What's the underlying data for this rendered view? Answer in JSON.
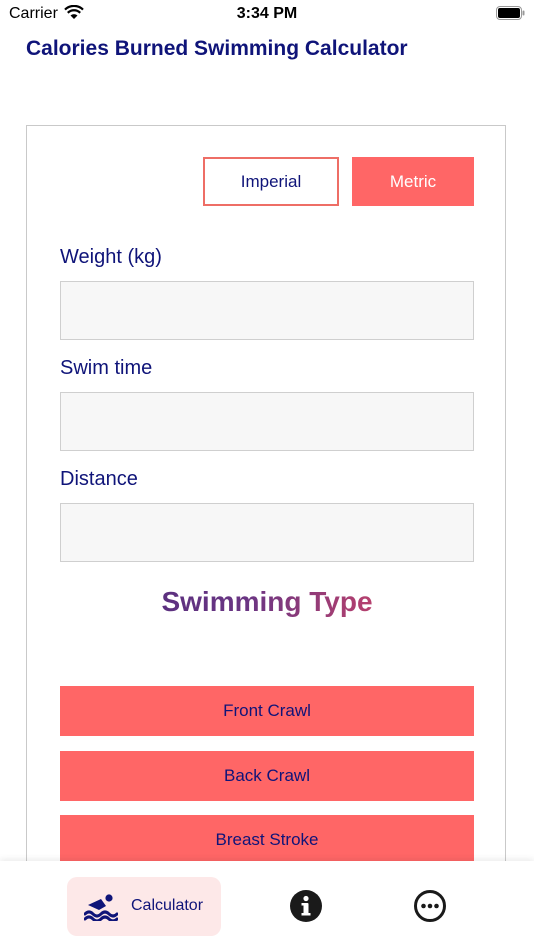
{
  "status_bar": {
    "carrier": "Carrier",
    "time": "3:34 PM"
  },
  "header": {
    "title": "Calories Burned Swimming Calculator"
  },
  "units": {
    "imperial_label": "Imperial",
    "metric_label": "Metric",
    "selected": "Metric"
  },
  "fields": [
    {
      "label": "Weight (kg)",
      "value": ""
    },
    {
      "label": "Swim time",
      "value": ""
    },
    {
      "label": "Distance",
      "value": ""
    }
  ],
  "swimming_type": {
    "title": "Swimming Type",
    "options": [
      "Front Crawl",
      "Back Crawl",
      "Breast Stroke"
    ]
  },
  "tab_bar": {
    "items": [
      {
        "label": "Calculator",
        "icon": "swimmer-icon",
        "active": true
      },
      {
        "label": "",
        "icon": "info-icon",
        "active": false
      },
      {
        "label": "",
        "icon": "more-icon",
        "active": false
      }
    ]
  },
  "colors": {
    "accent": "#ff6666",
    "navy": "#0f1479",
    "active_tab_bg": "#fde8e8"
  }
}
